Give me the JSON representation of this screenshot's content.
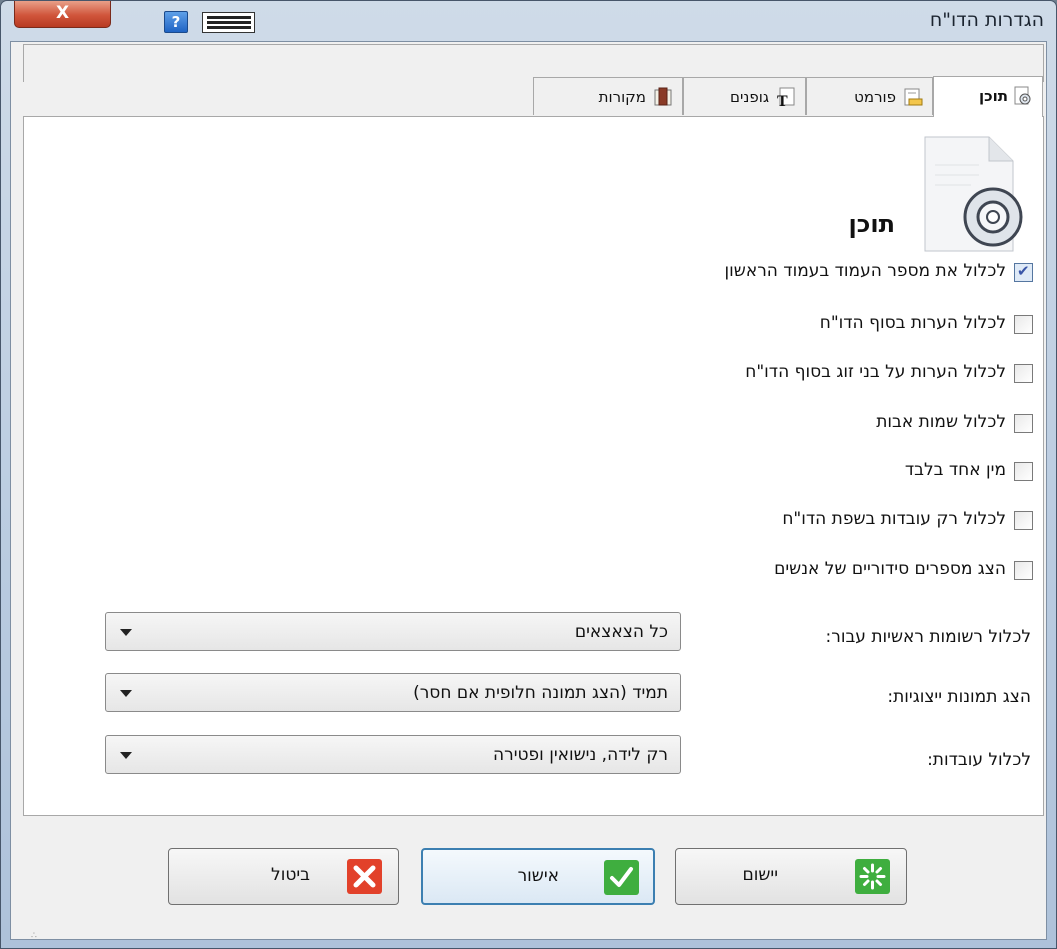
{
  "window": {
    "title": "הגדרות הדו\"ח"
  },
  "titlebar": {
    "close_label": "X",
    "help_label": "?"
  },
  "tabs": [
    {
      "label": "תוכן",
      "icon": "content-gear-icon",
      "active": true
    },
    {
      "label": "פורמט",
      "icon": "format-icon",
      "active": false
    },
    {
      "label": "גופנים",
      "icon": "fonts-icon",
      "active": false
    },
    {
      "label": "מקורות",
      "icon": "sources-icon",
      "active": false
    }
  ],
  "section": {
    "title": "תוכן",
    "icon": "document-gear-icon"
  },
  "options": [
    {
      "label": "לכלול את מספר העמוד בעמוד הראשון",
      "checked": true
    },
    {
      "label": "לכלול הערות בסוף הדו\"ח",
      "checked": false
    },
    {
      "label": "לכלול הערות על בני זוג בסוף הדו\"ח",
      "checked": false
    },
    {
      "label": "לכלול שמות אבות",
      "checked": false
    },
    {
      "label": "מין אחד בלבד",
      "checked": false
    },
    {
      "label": "לכלול רק עובדות בשפת הדו\"ח",
      "checked": false
    },
    {
      "label": "הצג מספרים סידוריים של אנשים",
      "checked": false
    }
  ],
  "fields": [
    {
      "label": "לכלול רשומות ראשיות עבור:",
      "value": "כל הצאצאים"
    },
    {
      "label": "הצג תמונות ייצוגיות:",
      "value": "תמיד (הצג תמונה חלופית אם חסר)"
    },
    {
      "label": "לכלול עובדות:",
      "value": "רק לידה, נישואין ופטירה"
    }
  ],
  "buttons": {
    "cancel": {
      "label": "ביטול",
      "icon": "cancel-x-icon",
      "color": "#e2412a"
    },
    "ok": {
      "label": "אישור",
      "icon": "ok-check-icon",
      "color": "#3fae3f"
    },
    "apply": {
      "label": "יישום",
      "icon": "apply-spark-icon",
      "color": "#3fae3f"
    }
  }
}
